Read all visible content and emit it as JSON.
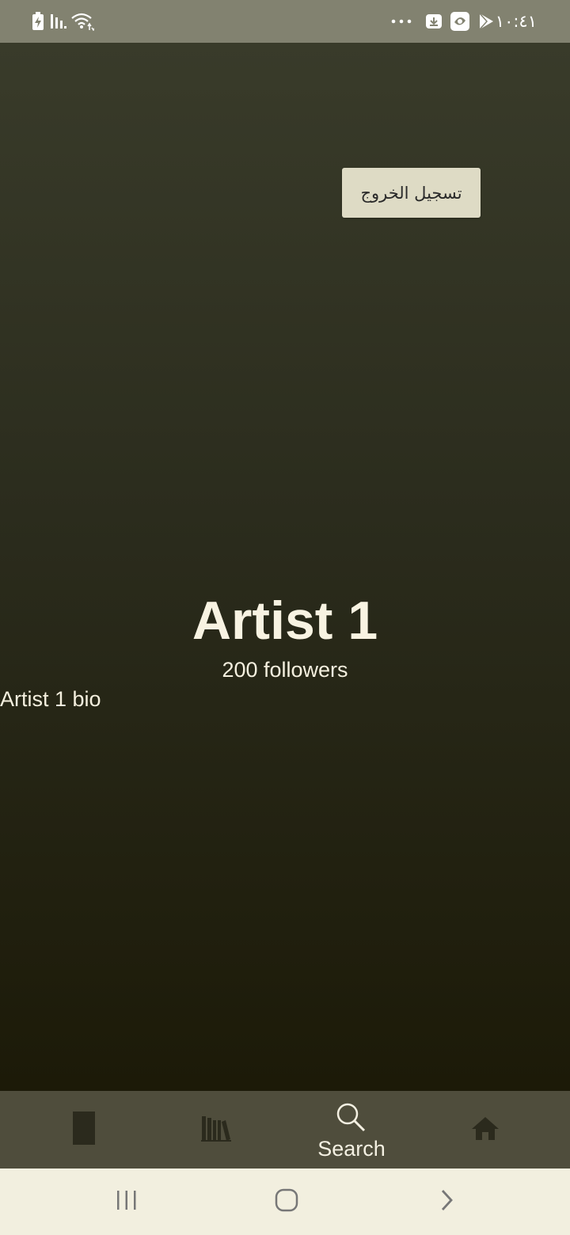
{
  "status_bar": {
    "time": "١٠:٤١",
    "icons": [
      "battery-charging-icon",
      "signal-icon",
      "wifi-icon",
      "more-dots-icon",
      "download-icon",
      "app-icon",
      "play-store-icon"
    ]
  },
  "main": {
    "logout_label": "تسجيل الخروج",
    "artist_name": "Artist 1",
    "followers": "200 followers",
    "bio": "Artist 1 bio"
  },
  "tab_bar": {
    "tabs": [
      {
        "name": "now-playing",
        "icon": "square-block-icon",
        "label": ""
      },
      {
        "name": "library",
        "icon": "books-icon",
        "label": ""
      },
      {
        "name": "search",
        "icon": "search-icon",
        "label": "Search",
        "active": true
      },
      {
        "name": "home",
        "icon": "home-icon",
        "label": ""
      }
    ]
  },
  "system_nav": {
    "buttons": [
      "recent-apps-icon",
      "home-circle-icon",
      "back-chevron-icon"
    ]
  },
  "colors": {
    "status_bar_bg": "#828270",
    "tab_bar_bg": "#4f4d3c",
    "nav_bar_bg": "#f2efdf",
    "button_bg": "#dedbc5",
    "text_light": "#f8f3e2"
  }
}
